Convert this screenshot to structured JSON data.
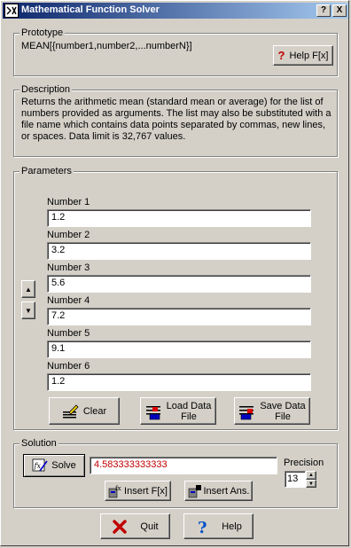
{
  "window": {
    "title": "Mathematical Function Solver",
    "help_glyph": "?",
    "close_glyph": "X"
  },
  "prototype": {
    "legend": "Prototype",
    "text": "MEAN[{number1,number2,...numberN}]",
    "help_button": "Help F[x]"
  },
  "description": {
    "legend": "Description",
    "text": "Returns the arithmetic mean (standard mean or average) for the list of numbers provided as arguments. The list may also be substituted with a file name which contains data points separated by commas, new lines, or spaces. Data limit is 32,767 values."
  },
  "parameters": {
    "legend": "Parameters",
    "fields": [
      {
        "label": "Number 1",
        "value": "1.2"
      },
      {
        "label": "Number 2",
        "value": "3.2"
      },
      {
        "label": "Number 3",
        "value": "5.6"
      },
      {
        "label": "Number 4",
        "value": "7.2"
      },
      {
        "label": "Number 5",
        "value": "9.1"
      },
      {
        "label": "Number 6",
        "value": "1.2"
      }
    ],
    "clear_button": "Clear",
    "load_button_line1": "Load Data",
    "load_button_line2": "File",
    "save_button_line1": "Save Data",
    "save_button_line2": "File"
  },
  "solution": {
    "legend": "Solution",
    "solve_button": "Solve",
    "result": "4.583333333333",
    "result_color": "#c00000",
    "precision_label": "Precision",
    "precision_value": "13",
    "insert_fx_button": "Insert F[x]",
    "insert_ans_button": "Insert Ans."
  },
  "footer": {
    "quit_button": "Quit",
    "help_button": "Help"
  },
  "icons": {
    "help": "question-mark-icon",
    "quit": "red-x-icon",
    "clear": "clear-pencil-icon",
    "load": "load-file-icon",
    "save": "save-file-icon",
    "solve": "solve-fx-icon"
  }
}
